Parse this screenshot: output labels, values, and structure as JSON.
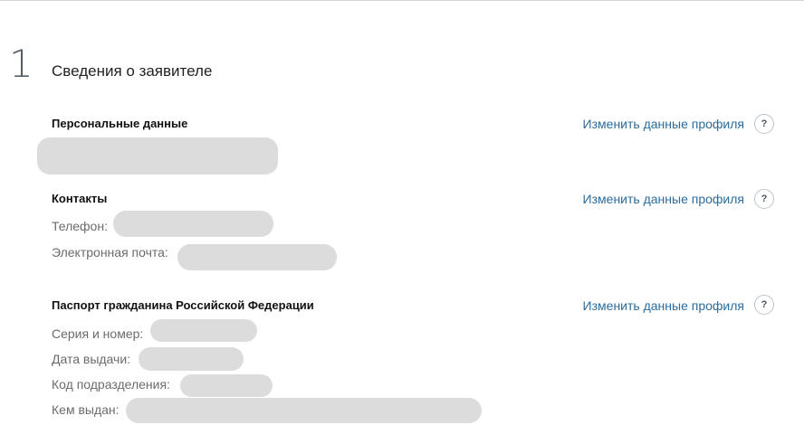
{
  "step": {
    "number": "1",
    "title": "Сведения о заявителе"
  },
  "personal": {
    "title": "Персональные данные",
    "edit_link": "Изменить данные профиля",
    "help_label": "?"
  },
  "contacts": {
    "title": "Контакты",
    "edit_link": "Изменить данные профиля",
    "help_label": "?",
    "phone_label": "Телефон:",
    "email_label": "Электронная почта:"
  },
  "passport": {
    "title": "Паспорт гражданина Российской Федерации",
    "edit_link": "Изменить данные профиля",
    "help_label": "?",
    "series_label": "Серия и номер:",
    "issue_date_label": "Дата выдачи:",
    "division_code_label": "Код подразделения:",
    "issued_by_label": "Кем выдан:"
  }
}
